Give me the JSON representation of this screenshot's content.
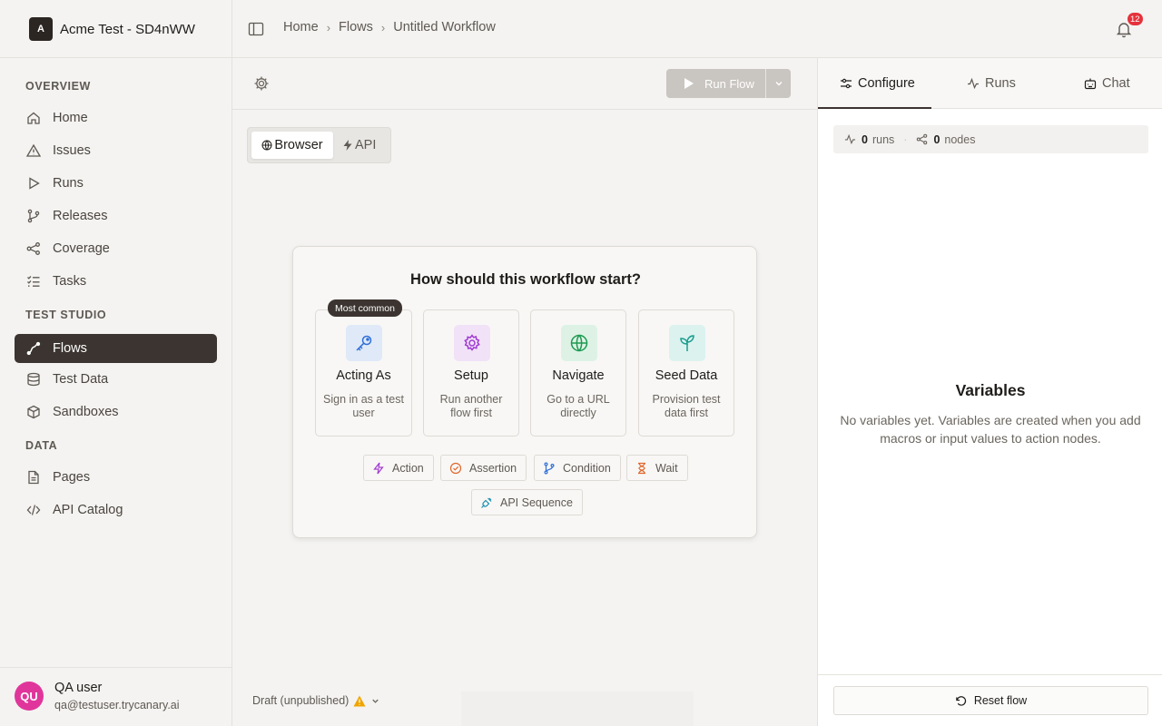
{
  "workspace": {
    "logo": "A",
    "name": "Acme Test - SD4nWW"
  },
  "sidebar": {
    "sections": [
      {
        "label": "OVERVIEW",
        "items": [
          {
            "label": "Home",
            "icon": "home-icon"
          },
          {
            "label": "Issues",
            "icon": "warning-icon"
          },
          {
            "label": "Runs",
            "icon": "play-icon"
          },
          {
            "label": "Releases",
            "icon": "git-branch-icon"
          },
          {
            "label": "Coverage",
            "icon": "nodes-icon"
          },
          {
            "label": "Tasks",
            "icon": "checklist-icon"
          }
        ]
      },
      {
        "label": "TEST STUDIO",
        "items": [
          {
            "label": "Flows",
            "icon": "flow-icon",
            "active": true
          },
          {
            "label": "Test Data",
            "icon": "database-icon"
          },
          {
            "label": "Sandboxes",
            "icon": "box-icon"
          }
        ]
      },
      {
        "label": "DATA",
        "items": [
          {
            "label": "Pages",
            "icon": "file-icon"
          },
          {
            "label": "API Catalog",
            "icon": "code-icon"
          }
        ]
      }
    ]
  },
  "user": {
    "initials": "QU",
    "name": "QA user",
    "email": "qa@testuser.trycanary.ai"
  },
  "breadcrumb": [
    "Home",
    "Flows",
    "Untitled Workflow"
  ],
  "notifications": {
    "count": "12"
  },
  "toolbar": {
    "run_label": "Run Flow"
  },
  "mode_tabs": {
    "browser": "Browser",
    "api": "API"
  },
  "start_card": {
    "title": "How should this workflow start?",
    "badge": "Most common",
    "options": [
      {
        "title": "Acting As",
        "desc": "Sign in as a test user",
        "icon": "key-icon",
        "color": "#2f6fd6"
      },
      {
        "title": "Setup",
        "desc": "Run another flow first",
        "icon": "gear-icon",
        "color": "#a03ad1"
      },
      {
        "title": "Navigate",
        "desc": "Go to a URL directly",
        "icon": "globe-icon",
        "color": "#1f9a52"
      },
      {
        "title": "Seed Data",
        "desc": "Provision test data first",
        "icon": "sprout-icon",
        "color": "#1a9c8e"
      }
    ],
    "node_types": [
      {
        "label": "Action",
        "icon": "bolt-icon",
        "color": "#a03ad1"
      },
      {
        "label": "Assertion",
        "icon": "check-circle-icon",
        "color": "#e0662b"
      },
      {
        "label": "Condition",
        "icon": "branch-icon",
        "color": "#2f6fd6"
      },
      {
        "label": "Wait",
        "icon": "hourglass-icon",
        "color": "#e0662b"
      },
      {
        "label": "API Sequence",
        "icon": "plug-icon",
        "color": "#1a8fb0"
      }
    ]
  },
  "status": {
    "draft_label": "Draft (unpublished)"
  },
  "right_panel": {
    "tabs": [
      "Configure",
      "Runs",
      "Chat"
    ],
    "stats": {
      "runs_count": "0",
      "runs_label": "runs",
      "nodes_count": "0",
      "nodes_label": "nodes"
    },
    "variables_title": "Variables",
    "variables_desc": "No variables yet. Variables are created when you add macros or input values to action nodes.",
    "reset_label": "Reset flow"
  }
}
